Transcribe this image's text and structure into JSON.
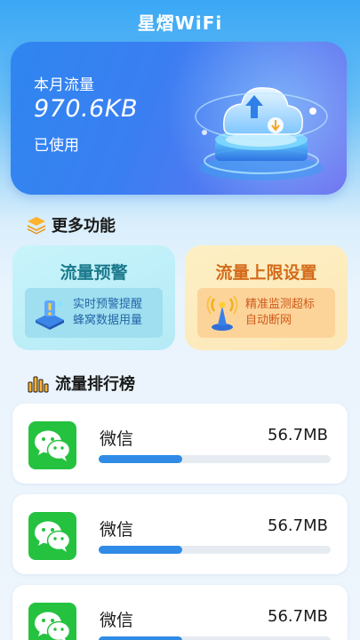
{
  "header": {
    "title": "星熠WiFi"
  },
  "hero": {
    "month_label": "本月流量",
    "used_value": "970.6KB",
    "used_label": "已使用"
  },
  "more_features": {
    "title": "更多功能",
    "cards": [
      {
        "title": "流量预警",
        "desc_line1": "实时预警提醒",
        "desc_line2": "蜂窝数据用量",
        "accent": "#1b7a8c"
      },
      {
        "title": "流量上限设置",
        "desc_line1": "精准监测超标",
        "desc_line2": "自动断网",
        "accent": "#d36b1a"
      }
    ]
  },
  "ranking": {
    "title": "流量排行榜",
    "items": [
      {
        "name": "微信",
        "usage": "56.7MB",
        "progress": 0.36,
        "icon": "wechat-icon"
      },
      {
        "name": "微信",
        "usage": "56.7MB",
        "progress": 0.36,
        "icon": "wechat-icon"
      },
      {
        "name": "微信",
        "usage": "56.7MB",
        "progress": 0.36,
        "icon": "wechat-icon"
      }
    ]
  },
  "colors": {
    "accent": "#2f8be6",
    "wechat": "#25c240",
    "hero_start": "#2f86f0",
    "hero_end": "#6f6ff0"
  }
}
